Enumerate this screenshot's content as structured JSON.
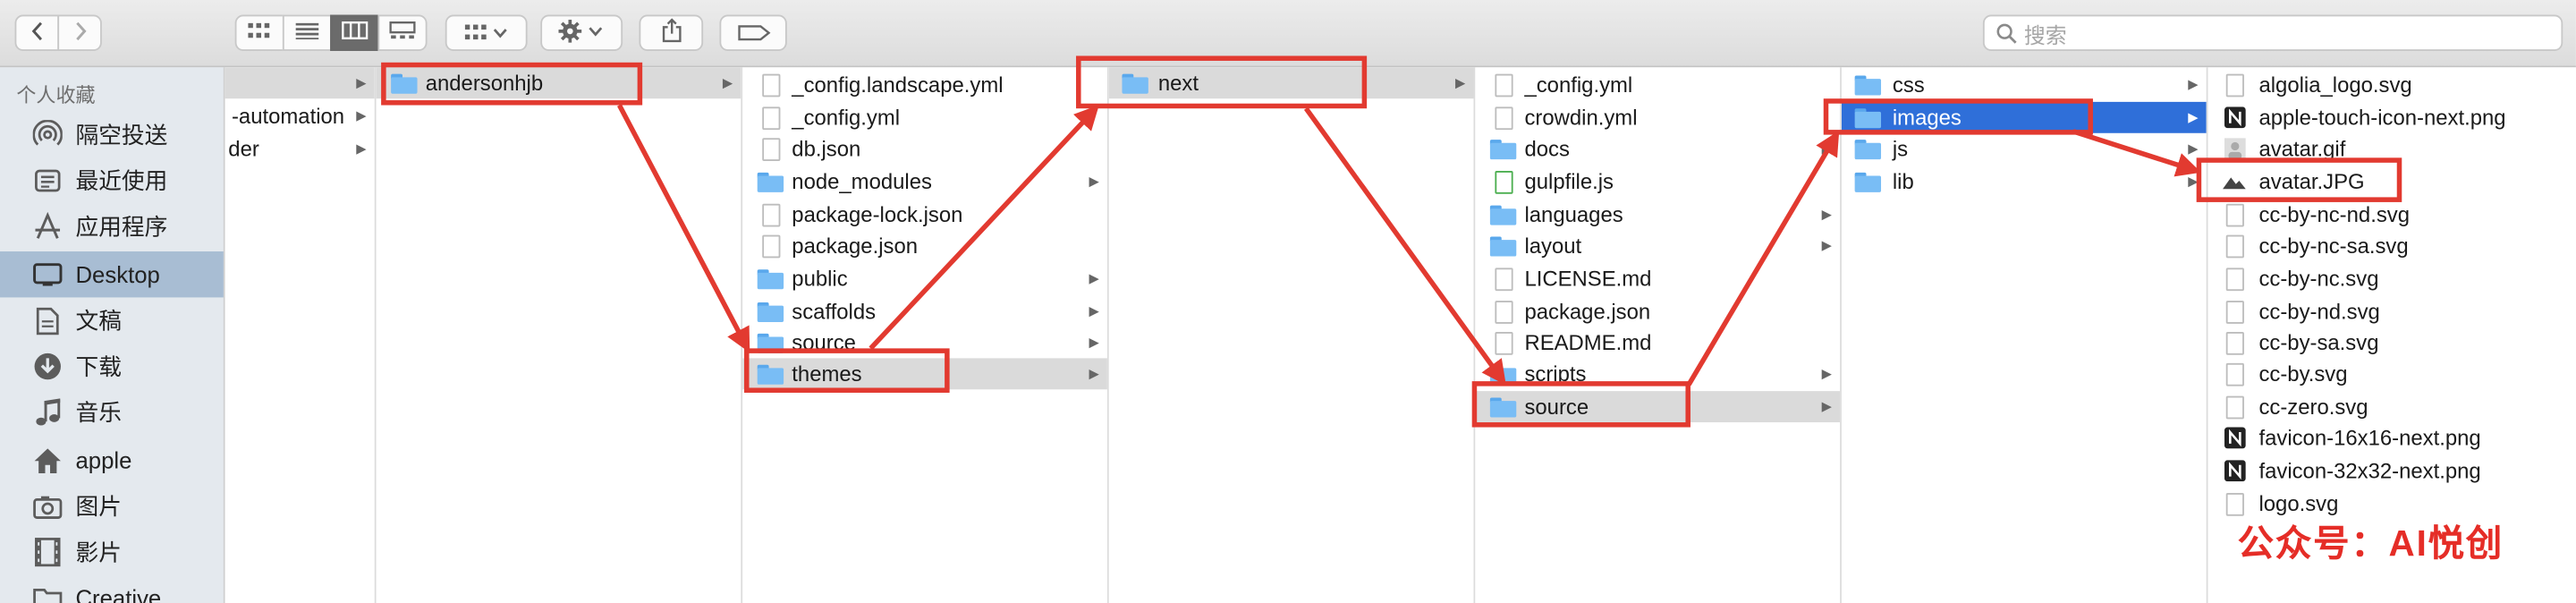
{
  "toolbar": {
    "search_placeholder": "搜索",
    "gear_icon": "gear-icon",
    "share_icon": "share-icon",
    "tag_icon": "tag-icon"
  },
  "sidebar": {
    "heading": "个人收藏",
    "items": [
      {
        "label": "隔空投送",
        "icon": "airdrop-icon"
      },
      {
        "label": "最近使用",
        "icon": "recents-icon"
      },
      {
        "label": "应用程序",
        "icon": "applications-icon"
      },
      {
        "label": "Desktop",
        "icon": "desktop-icon",
        "selected": true
      },
      {
        "label": "文稿",
        "icon": "documents-icon"
      },
      {
        "label": "下载",
        "icon": "downloads-icon"
      },
      {
        "label": "音乐",
        "icon": "music-icon"
      },
      {
        "label": "apple",
        "icon": "home-icon"
      },
      {
        "label": "图片",
        "icon": "pictures-icon"
      },
      {
        "label": "影片",
        "icon": "movies-icon"
      },
      {
        "label": "Creative",
        "icon": "folder-icon"
      }
    ]
  },
  "columns": [
    {
      "items": [
        {
          "label": "",
          "folder": true,
          "selected": true
        },
        {
          "label": "-automation",
          "folder": true
        },
        {
          "label": "der",
          "folder": true
        }
      ]
    },
    {
      "items": [
        {
          "label": "andersonhjb",
          "folder": true,
          "selected": true
        }
      ]
    },
    {
      "items": [
        {
          "label": "_config.landscape.yml",
          "folder": false
        },
        {
          "label": "_config.yml",
          "folder": false
        },
        {
          "label": "db.json",
          "folder": false
        },
        {
          "label": "node_modules",
          "folder": true
        },
        {
          "label": "package-lock.json",
          "folder": false
        },
        {
          "label": "package.json",
          "folder": false
        },
        {
          "label": "public",
          "folder": true
        },
        {
          "label": "scaffolds",
          "folder": true
        },
        {
          "label": "source",
          "folder": true
        },
        {
          "label": "themes",
          "folder": true,
          "selected": true
        }
      ]
    },
    {
      "items": [
        {
          "label": "next",
          "folder": true,
          "selected": true
        }
      ]
    },
    {
      "items": [
        {
          "label": "_config.yml",
          "folder": false
        },
        {
          "label": "crowdin.yml",
          "folder": false
        },
        {
          "label": "docs",
          "folder": true
        },
        {
          "label": "gulpfile.js",
          "folder": false
        },
        {
          "label": "languages",
          "folder": true
        },
        {
          "label": "layout",
          "folder": true
        },
        {
          "label": "LICENSE.md",
          "folder": false
        },
        {
          "label": "package.json",
          "folder": false
        },
        {
          "label": "README.md",
          "folder": false
        },
        {
          "label": "scripts",
          "folder": true
        },
        {
          "label": "source",
          "folder": true,
          "selected": true
        }
      ]
    },
    {
      "items": [
        {
          "label": "css",
          "folder": true
        },
        {
          "label": "images",
          "folder": true,
          "selected": true,
          "active": true
        },
        {
          "label": "js",
          "folder": true
        },
        {
          "label": "lib",
          "folder": true
        }
      ]
    },
    {
      "items": [
        {
          "label": "algolia_logo.svg",
          "folder": false
        },
        {
          "label": "apple-touch-icon-next.png",
          "folder": false
        },
        {
          "label": "avatar.gif",
          "folder": false
        },
        {
          "label": "avatar.JPG",
          "folder": false
        },
        {
          "label": "cc-by-nc-nd.svg",
          "folder": false
        },
        {
          "label": "cc-by-nc-sa.svg",
          "folder": false
        },
        {
          "label": "cc-by-nc.svg",
          "folder": false
        },
        {
          "label": "cc-by-nd.svg",
          "folder": false
        },
        {
          "label": "cc-by-sa.svg",
          "folder": false
        },
        {
          "label": "cc-by.svg",
          "folder": false
        },
        {
          "label": "cc-zero.svg",
          "folder": false
        },
        {
          "label": "favicon-16x16-next.png",
          "folder": false
        },
        {
          "label": "favicon-32x32-next.png",
          "folder": false
        },
        {
          "label": "logo.svg",
          "folder": false
        }
      ]
    }
  ],
  "watermark": "公众号：AI悦创",
  "colors": {
    "annotation_red": "#e23a30",
    "selection_blue": "#2f6fd9",
    "selection_grey": "#dadada",
    "sidebar_selected": "#a8bdd3",
    "folder_blue": "#79bdf5"
  }
}
